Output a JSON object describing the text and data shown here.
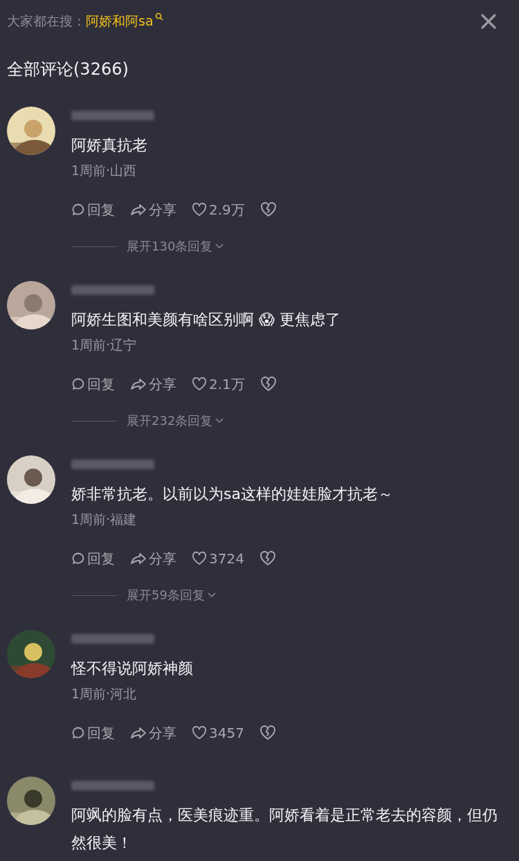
{
  "search_bar": {
    "label": "大家都在搜：",
    "keyword": "阿娇和阿sa"
  },
  "header": {
    "title": "全部评论(3266)"
  },
  "comments": [
    {
      "text": "阿娇真抗老",
      "meta": "1周前·山西",
      "reply": "回复",
      "share": "分享",
      "likes": "2.9万",
      "expand": "展开130条回复"
    },
    {
      "text": "阿娇生图和美颜有啥区别啊 😱 更焦虑了",
      "meta": "1周前·辽宁",
      "reply": "回复",
      "share": "分享",
      "likes": "2.1万",
      "expand": "展开232条回复"
    },
    {
      "text": "娇非常抗老。以前以为sa这样的娃娃脸才抗老～",
      "meta": "1周前·福建",
      "reply": "回复",
      "share": "分享",
      "likes": "3724",
      "expand": "展开59条回复"
    },
    {
      "text": "怪不得说阿娇神颜",
      "meta": "1周前·河北",
      "reply": "回复",
      "share": "分享",
      "likes": "3457"
    },
    {
      "text": "阿飒的脸有点，医美痕迹重。阿娇看着是正常老去的容颜，但仍然很美！"
    }
  ]
}
